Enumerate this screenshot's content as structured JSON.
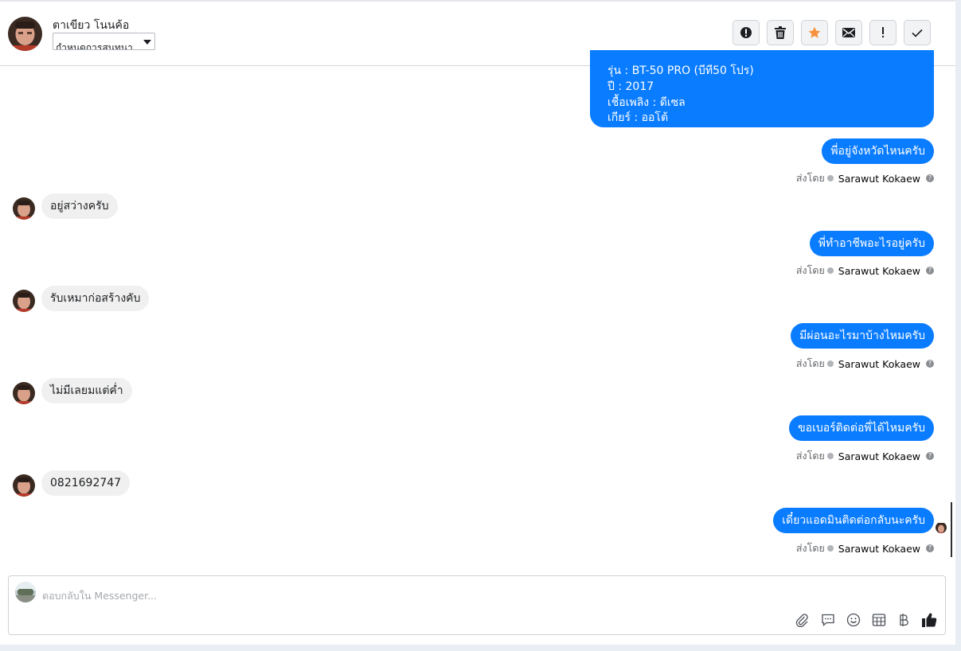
{
  "header": {
    "name": "ตาเขียว โนนค้อ",
    "assign_label": "กำหนดการสนทนา",
    "actions": [
      "spam-icon",
      "trash-icon",
      "star-icon",
      "mail-icon",
      "important-icon",
      "done-icon"
    ]
  },
  "car_info": {
    "model": "รุ่น : BT-50 PRO (บีที50 โปร)",
    "year": "ปี : 2017",
    "fuel": "เชื้อเพลิง : ดีเซล",
    "gear": "เกียร์ : ออโต้"
  },
  "messages": [
    {
      "dir": "out",
      "text": "พี่อยู่จังหวัดไหนครับ",
      "sent_prefix": "ส่งโดย",
      "sender": "Sarawut Kokaew"
    },
    {
      "dir": "in",
      "text": "อยู่สว่างครับ"
    },
    {
      "dir": "out",
      "text": "พี่ทำอาชีพอะไรอยู่ครับ",
      "sent_prefix": "ส่งโดย",
      "sender": "Sarawut Kokaew"
    },
    {
      "dir": "in",
      "text": "รับเหมาก่อสร้างคับ"
    },
    {
      "dir": "out",
      "text": "มีผ่อนอะไรมาบ้างไหมครับ",
      "sent_prefix": "ส่งโดย",
      "sender": "Sarawut Kokaew"
    },
    {
      "dir": "in",
      "text": "ไม่มีเลยมแต่ค่ำ"
    },
    {
      "dir": "out",
      "text": "ขอเบอร์ติดต่อพี่ได้ไหมครับ",
      "sent_prefix": "ส่งโดย",
      "sender": "Sarawut Kokaew"
    },
    {
      "dir": "in",
      "text": "0821692747"
    },
    {
      "dir": "out",
      "text": "เดี๋ยวแอดมินติดต่อกลับนะครับ",
      "sent_prefix": "ส่งโดย",
      "sender": "Sarawut Kokaew"
    }
  ],
  "composer": {
    "placeholder": "ตอบกลับใน Messenger...",
    "tools": [
      "attach-icon",
      "saved-reply-icon",
      "emoji-icon",
      "appointment-icon",
      "baht-icon",
      "like-icon"
    ]
  },
  "colors": {
    "outgoing": "#0a7cff",
    "incoming": "#f0f0f0",
    "star": "#f7923a"
  }
}
